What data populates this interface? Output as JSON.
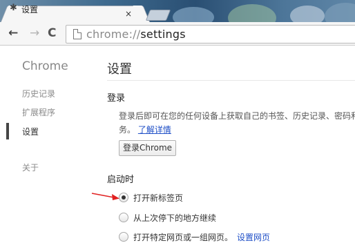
{
  "tab": {
    "title": "设置",
    "icon": "gear-icon",
    "close": "×"
  },
  "toolbar": {
    "back": "←",
    "forward": "→",
    "reload": "C",
    "url_scheme": "chrome://",
    "url_path": "settings"
  },
  "nav": {
    "brand": "Chrome",
    "items": [
      {
        "label": "历史记录"
      },
      {
        "label": "扩展程序"
      },
      {
        "label": "设置",
        "selected": true
      },
      {
        "label": "关于"
      }
    ]
  },
  "main": {
    "title": "设置",
    "signin": {
      "heading": "登录",
      "desc_line1": "登录后即可在您的任何设备上获取自己的书签、历史记录、密码和其",
      "desc_line2": "务。",
      "learn_more": "了解详情",
      "button": "登录Chrome"
    },
    "startup": {
      "heading": "启动时",
      "options": [
        {
          "label": "打开新标签页",
          "checked": true
        },
        {
          "label": "从上次停下的地方继续",
          "checked": false
        },
        {
          "label": "打开特定网页或一组网页。",
          "link": "设置网页",
          "checked": false
        }
      ]
    }
  },
  "colors": {
    "accent_link": "#1f4fc7",
    "annotation_arrow": "#e02020"
  }
}
